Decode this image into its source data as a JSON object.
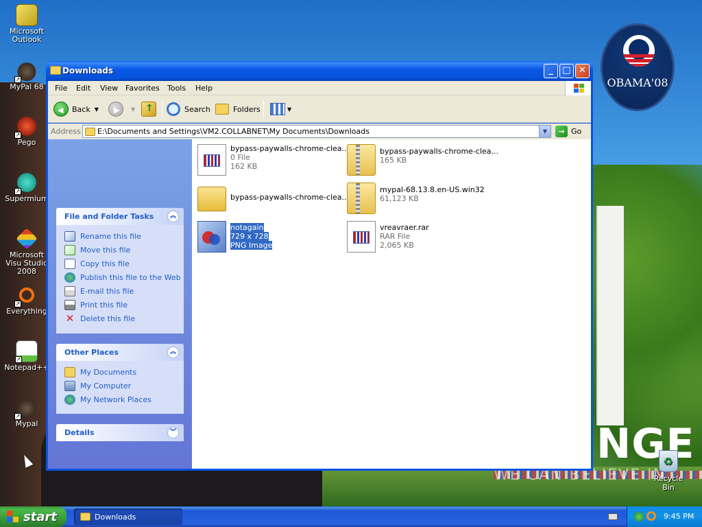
{
  "desktop": {
    "icons": [
      {
        "label": "Microsoft Outlook",
        "icon": "outlook-icon"
      },
      {
        "label": "MyPal 68",
        "icon": "raccoon-icon"
      },
      {
        "label": "Pego",
        "icon": "pego-icon"
      },
      {
        "label": "Supermium",
        "icon": "supermium-icon"
      },
      {
        "label": "Microsoft Visu Studio 2008",
        "icon": "visual-studio-icon"
      },
      {
        "label": "Everything",
        "icon": "everything-icon"
      },
      {
        "label": "Notepad++",
        "icon": "notepad-icon"
      },
      {
        "label": "Mypal",
        "icon": "raccoon-icon"
      }
    ],
    "recycle_bin": "Recycle Bin",
    "wallpaper": {
      "badge": "OBAMA'08",
      "slogan": "NGE",
      "slogan_sub": "WE CAN BELIEVE IN"
    }
  },
  "window": {
    "title": "Downloads",
    "menu": [
      "File",
      "Edit",
      "View",
      "Favorites",
      "Tools",
      "Help"
    ],
    "toolbar": {
      "back": "Back",
      "search": "Search",
      "folders": "Folders"
    },
    "address": {
      "label": "Address",
      "path": "E:\\Documents and Settings\\VM2.COLLABNET\\My Documents\\Downloads",
      "go": "Go"
    },
    "taskpane": {
      "file_tasks": {
        "title": "File and Folder Tasks",
        "items": [
          "Rename this file",
          "Move this file",
          "Copy this file",
          "Publish this file to the Web",
          "E-mail this file",
          "Print this file",
          "Delete this file"
        ]
      },
      "other_places": {
        "title": "Other Places",
        "items": [
          "My Documents",
          "My Computer",
          "My Network Places"
        ]
      },
      "details": {
        "title": "Details"
      }
    },
    "files": [
      {
        "name": "bypass-paywalls-chrome-clea...",
        "line2": "0 File",
        "line3": "162 KB",
        "type": "doc"
      },
      {
        "name": "bypass-paywalls-chrome-clea...",
        "line2": "165 KB",
        "line3": "",
        "type": "zip"
      },
      {
        "name": "bypass-paywalls-chrome-clea...",
        "line2": "",
        "line3": "",
        "type": "folder"
      },
      {
        "name": "mypal-68.13.8.en-US.win32",
        "line2": "61,123 KB",
        "line3": "",
        "type": "zip"
      },
      {
        "name": "notagain",
        "line2": "729 x 728",
        "line3": "PNG Image",
        "type": "png",
        "selected": true
      },
      {
        "name": "vreavraer.rar",
        "line2": "RAR File",
        "line3": "2,065 KB",
        "type": "doc"
      }
    ]
  },
  "taskbar": {
    "start": "start",
    "task": "Downloads",
    "clock": "9:45 PM"
  }
}
